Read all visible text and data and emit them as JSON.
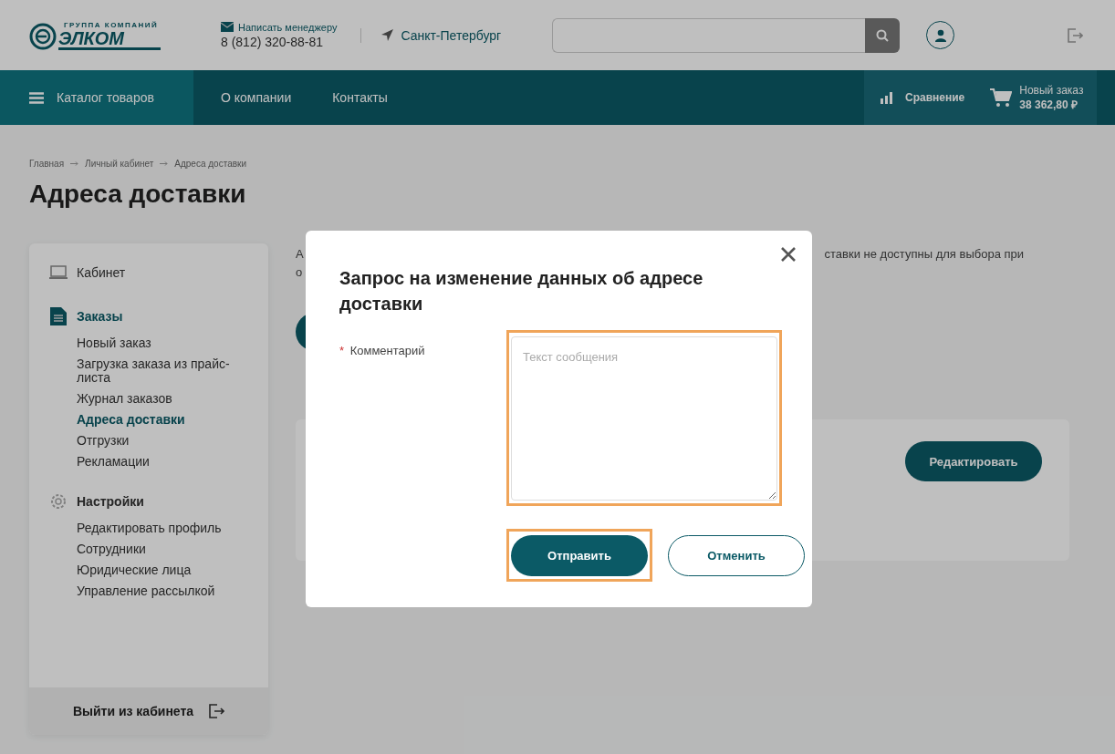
{
  "header": {
    "logo_caption": "ГРУППА КОМПАНИЙ",
    "logo_text": "ЭЛКОМ",
    "contact_link": "Написать менеджеру",
    "phone": "8 (812) 320-88-81",
    "city": "Санкт-Петербург"
  },
  "nav": {
    "catalog": "Каталог товаров",
    "links": [
      "О компании",
      "Контакты"
    ],
    "compare": "Сравнение",
    "cart_title": "Новый заказ",
    "cart_total": "38 362,80 ₽"
  },
  "breadcrumbs": [
    "Главная",
    "Личный кабинет",
    "Адреса доставки"
  ],
  "page_title": "Адреса доставки",
  "sidebar": {
    "sections": [
      {
        "kind": "cabinet",
        "title": "Кабинет",
        "selected": false
      },
      {
        "kind": "orders",
        "title": "Заказы",
        "selected": true,
        "items": [
          {
            "label": "Новый заказ",
            "selected": false
          },
          {
            "label": "Загрузка заказа из прайс-листа",
            "selected": false
          },
          {
            "label": "Журнал заказов",
            "selected": false
          },
          {
            "label": "Адреса доставки",
            "selected": true
          },
          {
            "label": "Отгрузки",
            "selected": false
          },
          {
            "label": "Рекламации",
            "selected": false
          }
        ]
      },
      {
        "kind": "settings",
        "title": "Настройки",
        "selected": false,
        "items": [
          {
            "label": "Редактировать профиль",
            "selected": false
          },
          {
            "label": "Сотрудники",
            "selected": false
          },
          {
            "label": "Юридические лица",
            "selected": false
          },
          {
            "label": "Управление рассылкой",
            "selected": false
          }
        ]
      }
    ],
    "logout": "Выйти из кабинета"
  },
  "notice_fragments": [
    "А",
    "ставки не доступны для выбора при",
    "о"
  ],
  "address_card": {
    "edit_button": "Редактировать"
  },
  "modal": {
    "title": "Запрос на изменение данных об адресе доставки",
    "field_label": "Комментарий",
    "required_mark": "*",
    "placeholder": "Текст сообщения",
    "field_highlighted": true,
    "buttons": [
      {
        "label": "Отправить",
        "kind": "primary",
        "highlighted": true
      },
      {
        "label": "Отменить",
        "kind": "secondary",
        "highlighted": false
      }
    ]
  }
}
